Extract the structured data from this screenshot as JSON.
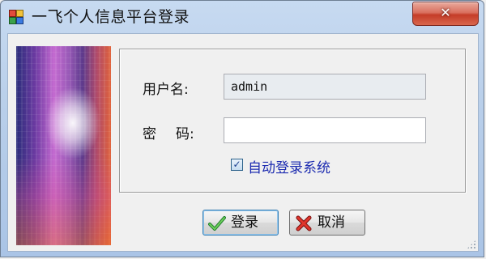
{
  "window": {
    "title": "一飞个人信息平台登录",
    "close_icon": "close-icon"
  },
  "form": {
    "username_label": "用户名:",
    "username_value": "admin",
    "password_label_1": "密",
    "password_label_2": "码:",
    "password_value": "",
    "auto_login_label": "自动登录系统",
    "auto_login_checked": true
  },
  "buttons": {
    "login_label": "登录",
    "cancel_label": "取消"
  },
  "colors": {
    "auto_login_text": "#1c2bb0",
    "close_button": "#c43c28"
  }
}
